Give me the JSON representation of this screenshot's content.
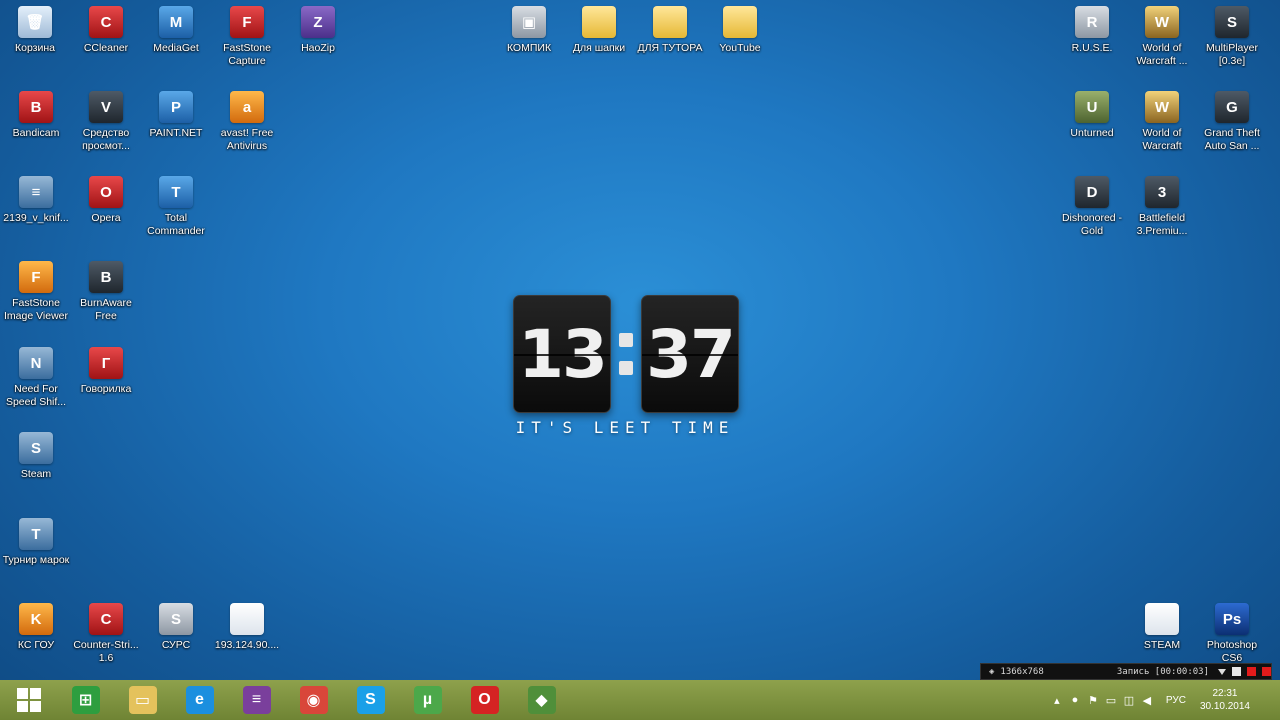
{
  "desktop_icons": [
    {
      "label": "Корзина",
      "icon": "recycle-bin-icon",
      "color": "recycle",
      "glyph": "🗑"
    },
    {
      "label": "CCleaner",
      "icon": "ccleaner-icon",
      "color": "red",
      "glyph": "C"
    },
    {
      "label": "MediaGet",
      "icon": "mediaget-icon",
      "color": "blue",
      "glyph": "M"
    },
    {
      "label": "FastStone Capture",
      "icon": "faststone-capture-icon",
      "color": "red",
      "glyph": "F"
    },
    {
      "label": "HaoZip",
      "icon": "haozip-icon",
      "color": "purple",
      "glyph": "Z"
    },
    {
      "label": "КОМПИК",
      "icon": "computer-icon",
      "color": "gray",
      "glyph": "▣"
    },
    {
      "label": "Для шапки",
      "icon": "folder-icon",
      "color": "folder",
      "glyph": ""
    },
    {
      "label": "ДЛЯ ТУТОРА",
      "icon": "folder-icon",
      "color": "folder",
      "glyph": ""
    },
    {
      "label": "YouTube",
      "icon": "folder-icon",
      "color": "folder",
      "glyph": ""
    },
    {
      "label": "R.U.S.E.",
      "icon": "ruse-icon",
      "color": "gray",
      "glyph": "R"
    },
    {
      "label": "World of Warcraft ...",
      "icon": "warcraft-icon",
      "color": "gold",
      "glyph": "W"
    },
    {
      "label": "MultiPlayer [0.3e]",
      "icon": "samp-icon",
      "color": "dark",
      "glyph": "S"
    },
    {
      "label": "Bandicam",
      "icon": "bandicam-icon",
      "color": "red",
      "glyph": "B"
    },
    {
      "label": "Средство просмот...",
      "icon": "viewer-icon",
      "color": "dark",
      "glyph": "V"
    },
    {
      "label": "PAINT.NET",
      "icon": "paintnet-icon",
      "color": "blue",
      "glyph": "P"
    },
    {
      "label": "avast! Free Antivirus",
      "icon": "avast-icon",
      "color": "orange",
      "glyph": "a"
    },
    {
      "label": "Unturned",
      "icon": "unturned-icon",
      "color": "olive",
      "glyph": "U"
    },
    {
      "label": "World of Warcraft",
      "icon": "warcraft-icon",
      "color": "gold",
      "glyph": "W"
    },
    {
      "label": "Grand Theft Auto San ...",
      "icon": "gta-icon",
      "color": "dark",
      "glyph": "G"
    },
    {
      "label": "2139_v_knif...",
      "icon": "winrar-archive-icon",
      "color": "steel",
      "glyph": "≡"
    },
    {
      "label": "Opera",
      "icon": "opera-icon",
      "color": "red",
      "glyph": "O"
    },
    {
      "label": "Total Commander",
      "icon": "floppy-icon",
      "color": "blue",
      "glyph": "T"
    },
    {
      "label": "Dishonored - Gold",
      "icon": "dishonored-icon",
      "color": "dark",
      "glyph": "D"
    },
    {
      "label": "Battlefield 3.Premiu...",
      "icon": "battlefield-icon",
      "color": "dark",
      "glyph": "3"
    },
    {
      "label": "FastStone Image Viewer",
      "icon": "faststone-viewer-icon",
      "color": "orange",
      "glyph": "F"
    },
    {
      "label": "BurnAware Free",
      "icon": "burnaware-icon",
      "color": "dark",
      "glyph": "B"
    },
    {
      "label": "Need For Speed Shif...",
      "icon": "shortcut-icon",
      "color": "steel",
      "glyph": "N"
    },
    {
      "label": "Говорилка",
      "icon": "govorilka-icon",
      "color": "red",
      "glyph": "Г"
    },
    {
      "label": "Steam",
      "icon": "steam-icon",
      "color": "steel",
      "glyph": "S"
    },
    {
      "label": "Турнир марок",
      "icon": "shortcut-icon",
      "color": "steel",
      "glyph": "T"
    },
    {
      "label": "КС ГОУ",
      "icon": "csgo-icon",
      "color": "orange",
      "glyph": "K"
    },
    {
      "label": "Counter-Stri... 1.6",
      "icon": "counter-strike-icon",
      "color": "red",
      "glyph": "C"
    },
    {
      "label": "СУРС",
      "icon": "css-icon",
      "color": "gray",
      "glyph": "S"
    },
    {
      "label": "193.124.90....",
      "icon": "file-icon",
      "color": "file",
      "glyph": ""
    },
    {
      "label": "STEAM",
      "icon": "file-icon",
      "color": "file",
      "glyph": ""
    },
    {
      "label": "Photoshop CS6",
      "icon": "photoshop-icon",
      "color": "ps",
      "glyph": "Ps"
    }
  ],
  "clock": {
    "hours": "13",
    "minutes": "37",
    "tagline": "IT'S LEET TIME"
  },
  "recorder": {
    "resolution": "1366x768",
    "status": "Запись [00:00:03]"
  },
  "taskbar": {
    "apps": [
      {
        "icon": "store-icon",
        "glyph": "⊞",
        "color": "#2e9e3f"
      },
      {
        "icon": "file-explorer-icon",
        "glyph": "▭",
        "color": "#e4c25c"
      },
      {
        "icon": "internet-explorer-icon",
        "glyph": "e",
        "color": "#1b8fdf"
      },
      {
        "icon": "winrar-icon",
        "glyph": "≡",
        "color": "#7a3f9c"
      },
      {
        "icon": "chrome-icon",
        "glyph": "◉",
        "color": "#d9463a"
      },
      {
        "icon": "skype-icon",
        "glyph": "S",
        "color": "#1aa0e8"
      },
      {
        "icon": "utorrent-icon",
        "glyph": "µ",
        "color": "#4ca84a"
      },
      {
        "icon": "opera-icon",
        "glyph": "O",
        "color": "#d52323"
      },
      {
        "icon": "shield-app-icon",
        "glyph": "◆",
        "color": "#4f8f3a"
      }
    ],
    "tray": {
      "language": "РУС",
      "time": "22:31",
      "date": "30.10.2014"
    }
  }
}
